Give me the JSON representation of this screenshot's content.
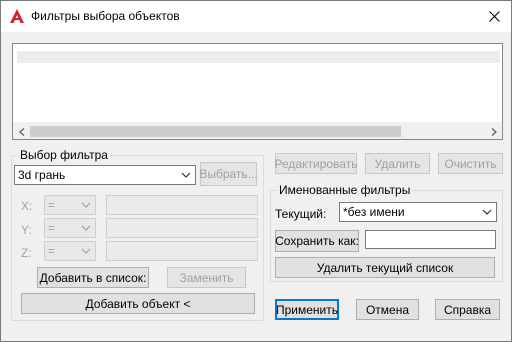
{
  "window": {
    "title": "Фильтры выбора объектов",
    "app_icon": "autocad-icon",
    "close_icon": "close-icon"
  },
  "top_buttons": {
    "edit": "Редактировать",
    "delete": "Удалить",
    "clear": "Очистить"
  },
  "filter_select": {
    "legend": "Выбор фильтра",
    "type_value": "3d грань",
    "select_button": "Выбрать...",
    "x_label": "X:",
    "y_label": "Y:",
    "z_label": "Z:",
    "operator_value": "=",
    "add_to_list": "Добавить в список:",
    "replace": "Заменить",
    "add_object": "Добавить объект <"
  },
  "named_filters": {
    "legend": "Именованные фильтры",
    "current_label": "Текущий:",
    "current_value": "*без имени",
    "save_as": "Сохранить как:",
    "save_as_value": "",
    "delete_current": "Удалить текущий список"
  },
  "bottom_buttons": {
    "apply": "Применить",
    "cancel": "Отмена",
    "help": "Справка"
  }
}
